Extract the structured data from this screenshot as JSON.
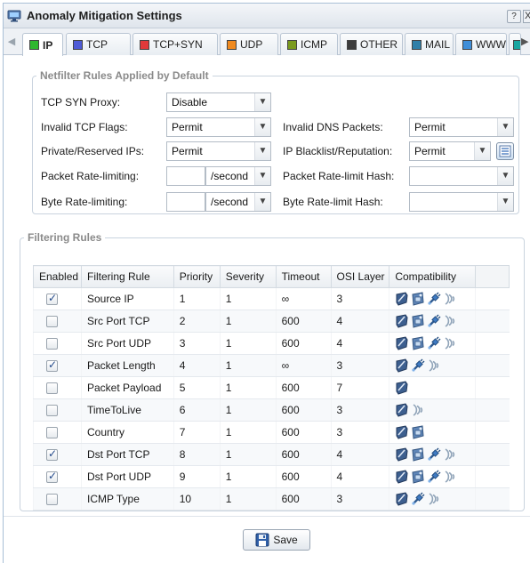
{
  "window": {
    "title": "Anomaly Mitigation Settings",
    "help_label": "?",
    "close_label": "X"
  },
  "tabs": [
    {
      "label": "IP",
      "color": "#2fb82f",
      "active": true
    },
    {
      "label": "TCP",
      "color": "#4f5bd6"
    },
    {
      "label": "TCP+SYN",
      "color": "#e03a3a"
    },
    {
      "label": "UDP",
      "color": "#f08a1f"
    },
    {
      "label": "ICMP",
      "color": "#7a9a1e"
    },
    {
      "label": "OTHER",
      "color": "#3c3c3c"
    },
    {
      "label": "MAIL",
      "color": "#2f7fa8"
    },
    {
      "label": "WWW",
      "color": "#3f8ed8"
    },
    {
      "label": "",
      "color": "#19a6a0"
    }
  ],
  "netfilter": {
    "legend": "Netfilter Rules Applied by Default",
    "tcp_syn_proxy": {
      "label": "TCP SYN Proxy:",
      "value": "Disable"
    },
    "invalid_tcp_flags": {
      "label": "Invalid TCP Flags:",
      "value": "Permit"
    },
    "invalid_dns": {
      "label": "Invalid DNS Packets:",
      "value": "Permit"
    },
    "private_ips": {
      "label": "Private/Reserved IPs:",
      "value": "Permit"
    },
    "ip_blacklist": {
      "label": "IP Blacklist/Reputation:",
      "value": "Permit"
    },
    "packet_rate": {
      "label": "Packet Rate-limiting:",
      "value": "",
      "unit": "/second"
    },
    "packet_rate_hash": {
      "label": "Packet Rate-limit Hash:",
      "value": ""
    },
    "byte_rate": {
      "label": "Byte Rate-limiting:",
      "value": "",
      "unit": "/second"
    },
    "byte_rate_hash": {
      "label": "Byte Rate-limit Hash:",
      "value": ""
    }
  },
  "filtering": {
    "legend": "Filtering Rules",
    "columns": [
      "Enabled",
      "Filtering Rule",
      "Priority",
      "Severity",
      "Timeout",
      "OSI Layer",
      "Compatibility"
    ],
    "rows": [
      {
        "enabled": true,
        "rule": "Source IP",
        "priority": "1",
        "severity": "1",
        "timeout": "∞",
        "osi": "3",
        "compat": [
          "shield",
          "firewall",
          "plug",
          "wave"
        ]
      },
      {
        "enabled": false,
        "rule": "Src Port TCP",
        "priority": "2",
        "severity": "1",
        "timeout": "600",
        "osi": "4",
        "compat": [
          "shield",
          "firewall",
          "plug",
          "wave"
        ]
      },
      {
        "enabled": false,
        "rule": "Src Port UDP",
        "priority": "3",
        "severity": "1",
        "timeout": "600",
        "osi": "4",
        "compat": [
          "shield",
          "firewall",
          "plug",
          "wave"
        ]
      },
      {
        "enabled": true,
        "rule": "Packet Length",
        "priority": "4",
        "severity": "1",
        "timeout": "∞",
        "osi": "3",
        "compat": [
          "shield",
          "plug",
          "wave"
        ]
      },
      {
        "enabled": false,
        "rule": "Packet Payload",
        "priority": "5",
        "severity": "1",
        "timeout": "600",
        "osi": "7",
        "compat": [
          "shield"
        ]
      },
      {
        "enabled": false,
        "rule": "TimeToLive",
        "priority": "6",
        "severity": "1",
        "timeout": "600",
        "osi": "3",
        "compat": [
          "shield",
          "wave"
        ]
      },
      {
        "enabled": false,
        "rule": "Country",
        "priority": "7",
        "severity": "1",
        "timeout": "600",
        "osi": "3",
        "compat": [
          "shield",
          "firewall"
        ]
      },
      {
        "enabled": true,
        "rule": "Dst Port TCP",
        "priority": "8",
        "severity": "1",
        "timeout": "600",
        "osi": "4",
        "compat": [
          "shield",
          "firewall",
          "plug",
          "wave"
        ]
      },
      {
        "enabled": true,
        "rule": "Dst Port UDP",
        "priority": "9",
        "severity": "1",
        "timeout": "600",
        "osi": "4",
        "compat": [
          "shield",
          "firewall",
          "plug",
          "wave"
        ]
      },
      {
        "enabled": false,
        "rule": "ICMP Type",
        "priority": "10",
        "severity": "1",
        "timeout": "600",
        "osi": "3",
        "compat": [
          "shield",
          "plug",
          "wave"
        ]
      }
    ]
  },
  "footer": {
    "save_label": "Save"
  }
}
